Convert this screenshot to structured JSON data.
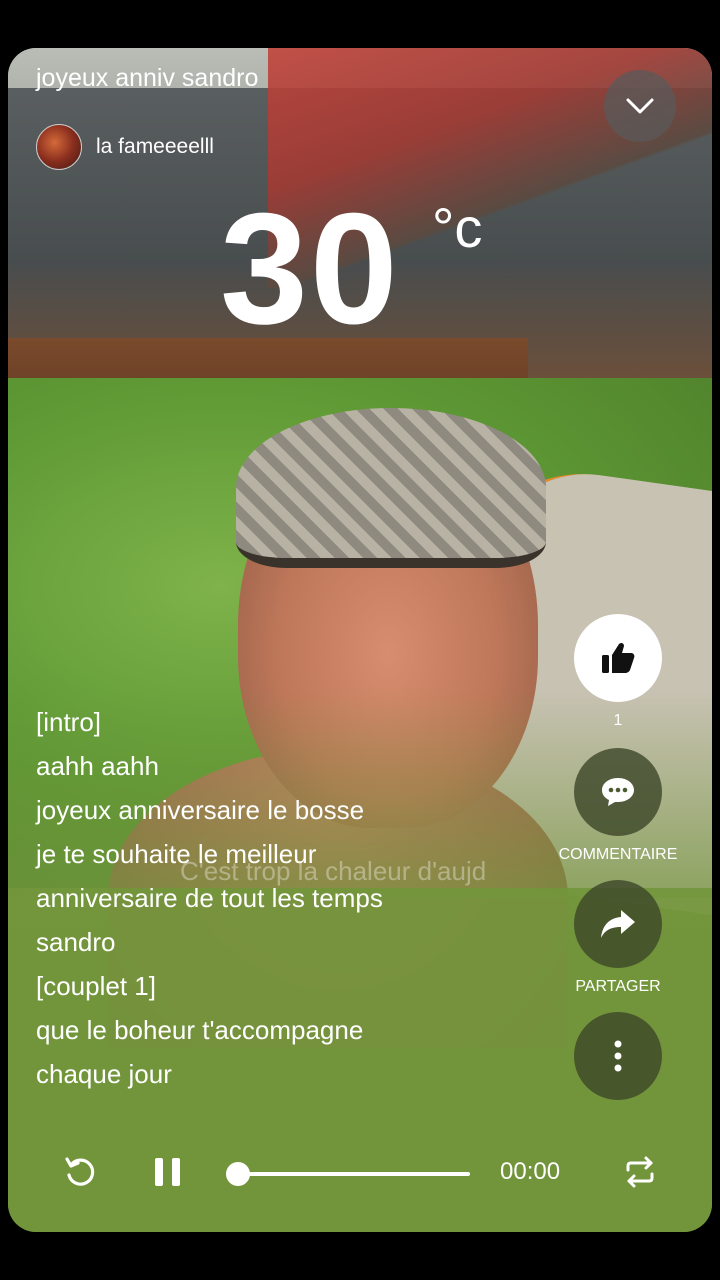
{
  "header": {
    "title": "joyeux anniv sandro",
    "profile_name": "la fameeeelll"
  },
  "weather": {
    "temperature": "30",
    "unit": "°c"
  },
  "lyrics": [
    "[intro]",
    "aahh aahh",
    "joyeux anniversaire le bosse",
    "je te souhaite le meilleur",
    "anniversaire de tout les temps",
    "sandro",
    "[couplet 1]",
    "que le boheur t'accompagne",
    "chaque jour"
  ],
  "ghost_caption": "C'est trop la chaleur d'aujd",
  "actions": {
    "like_count": "1",
    "comment_label": "COMMENTAIRE",
    "share_label": "PARTAGER"
  },
  "player": {
    "time": "00:00",
    "progress": 0.0
  },
  "icons": {
    "collapse": "chevron-down-icon",
    "like": "thumbs-up-icon",
    "comment": "speech-bubble-icon",
    "share": "share-arrow-icon",
    "more": "more-vertical-icon",
    "replay": "replay-icon",
    "pause": "pause-icon",
    "repeat": "repeat-icon"
  }
}
